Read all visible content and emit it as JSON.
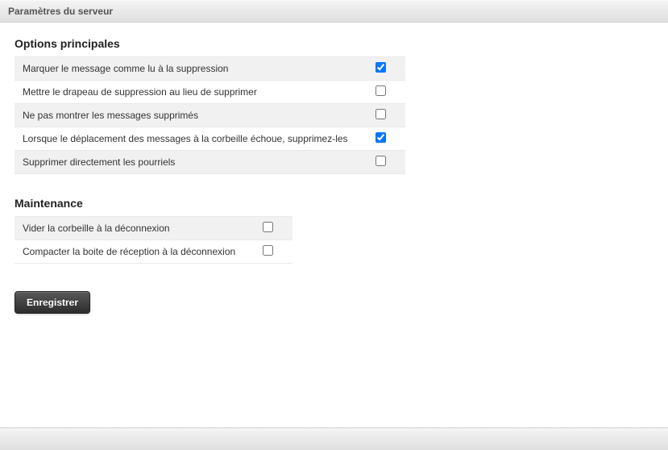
{
  "header": {
    "title": "Paramètres du serveur"
  },
  "sections": {
    "main": {
      "title": "Options principales",
      "options": [
        {
          "label": "Marquer le message comme lu à la suppression",
          "checked": true
        },
        {
          "label": "Mettre le drapeau de suppression au lieu de supprimer",
          "checked": false
        },
        {
          "label": "Ne pas montrer les messages supprimés",
          "checked": false
        },
        {
          "label": "Lorsque le déplacement des messages à la corbeille échoue, supprimez-les",
          "checked": true
        },
        {
          "label": "Supprimer directement les pourriels",
          "checked": false
        }
      ]
    },
    "maintenance": {
      "title": "Maintenance",
      "options": [
        {
          "label": "Vider la corbeille à la déconnexion",
          "checked": false
        },
        {
          "label": "Compacter la boite de réception à la déconnexion",
          "checked": false
        }
      ]
    }
  },
  "actions": {
    "save": "Enregistrer"
  }
}
